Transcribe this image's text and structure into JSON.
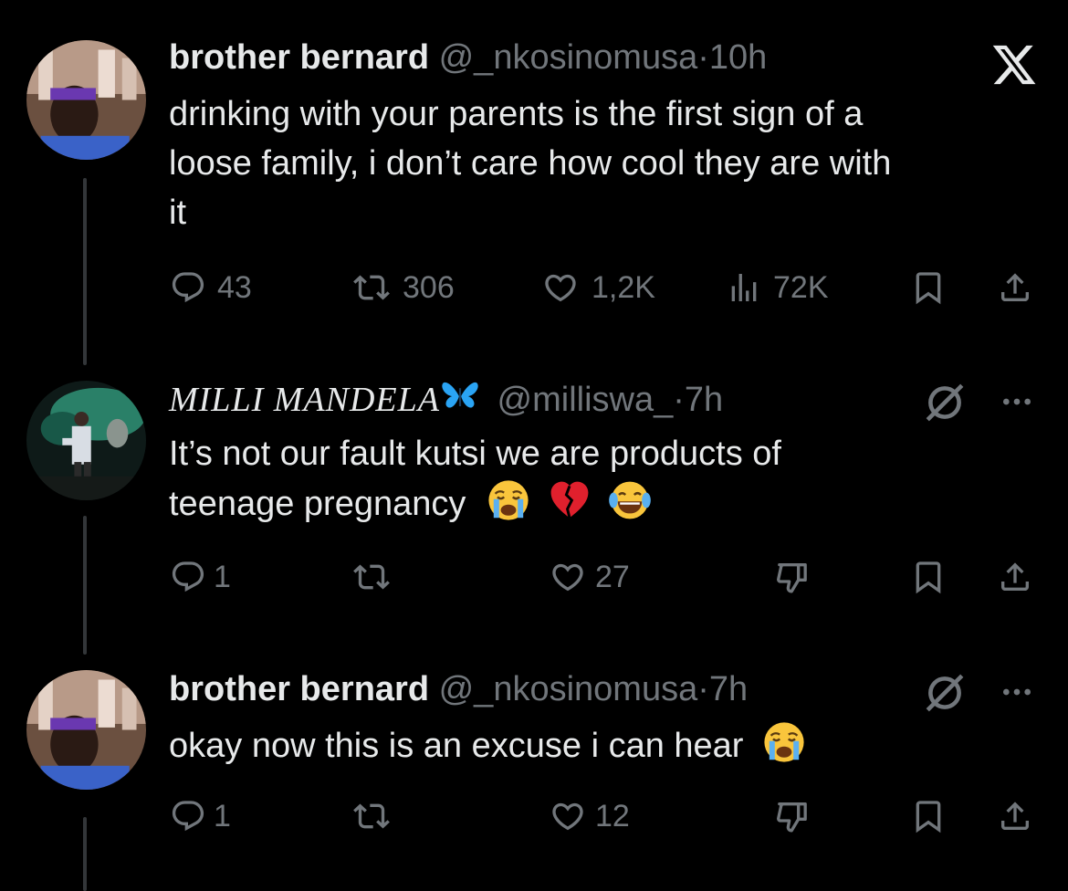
{
  "tweets": [
    {
      "name": "brother bernard",
      "handle": "@_nkosinomusa",
      "sep": "·",
      "time": "10h",
      "lines": [
        "drinking with your parents is the first sign of a",
        "loose family, i don’t care how cool they are with",
        "it"
      ],
      "replies": "43",
      "retweets": "306",
      "likes": "1,2K",
      "views": "72K",
      "corner_icon": "x-logo-icon"
    },
    {
      "name": "MILLI MANDELA",
      "name_emoji": "blue-butterfly-emoji",
      "handle": "@milliswa_",
      "sep": "·",
      "time": "7h",
      "lines": [
        "It’s not our fault kutsi we are products of",
        "teenage pregnancy"
      ],
      "line_emojis": [
        "loudly-crying-face-emoji",
        "broken-heart-emoji",
        "face-with-tears-of-joy-emoji"
      ],
      "replies": "1",
      "retweets": "",
      "likes": "27",
      "corner_icon": "grok-icon"
    },
    {
      "name": "brother bernard",
      "handle": "@_nkosinomusa",
      "sep": "·",
      "time": "7h",
      "lines": [
        "okay now this is an excuse i can hear"
      ],
      "line_emojis": [
        "loudly-crying-face-emoji"
      ],
      "replies": "1",
      "retweets": "",
      "likes": "12",
      "corner_icon": "grok-icon"
    }
  ],
  "colors": {
    "background": "#000000",
    "text": "#e7e9ea",
    "muted": "#71767b",
    "thread_line": "#333639"
  }
}
